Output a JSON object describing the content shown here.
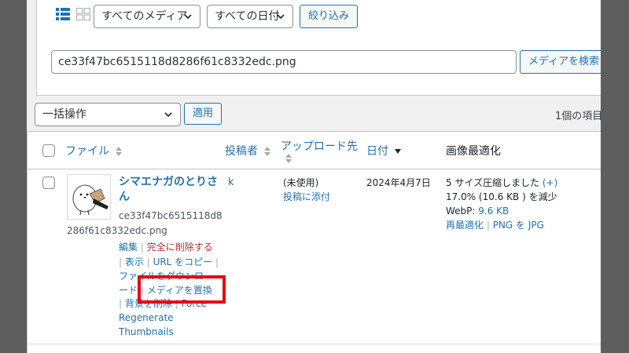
{
  "filters": {
    "media_type": "すべてのメディア",
    "date": "すべての日付",
    "filter_button": "絞り込み"
  },
  "search": {
    "value": "ce33f47bc6515118d8286f61c8332edc.png",
    "button": "メディアを検索"
  },
  "bulk": {
    "select": "一括操作",
    "apply": "適用"
  },
  "item_count": "1個の項目",
  "columns": {
    "file": "ファイル",
    "author": "投稿者",
    "uploaded_to": "アップロード先",
    "date": "日付",
    "optimization": "画像最適化"
  },
  "row": {
    "title_line1": "シマエナガのとりさ",
    "title_line2": "ん",
    "filename_line1": "ce33f47bc6515118d8",
    "filename_line2": "286f61c8332edc.png",
    "actions": {
      "edit": "編集",
      "delete": "完全に削除する",
      "view": "表示",
      "copy_url": "URL をコピー",
      "download_line1": "ファイルをダウンロ",
      "download_line2": "ード",
      "replace": "メディアを置換",
      "remove_bg": "背景を削除",
      "force": "Force",
      "regenerate": "Regenerate",
      "thumbnails": "Thumbnails"
    },
    "author": "k",
    "uploaded_to": "(未使用)",
    "attach": "投稿に添付",
    "date": "2024年4月7日",
    "optimization": {
      "line1": "5 サイズ圧縮しました",
      "line1_link": "(+)",
      "line2": "17.0% (10.6 KB ) を減少",
      "webp_label": "WebP:",
      "webp_value": "9.6 KB",
      "reoptimize": "再最適化",
      "png_to_jpg": "PNG を JPG"
    }
  },
  "colors": {
    "link": "#2271b1",
    "delete": "#b32d2e",
    "highlight": "#e60012"
  }
}
